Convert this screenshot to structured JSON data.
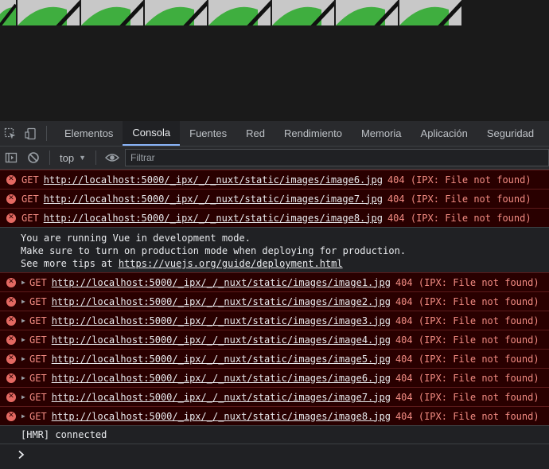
{
  "tabs": [
    {
      "label": "Elementos"
    },
    {
      "label": "Consola",
      "active": true
    },
    {
      "label": "Fuentes"
    },
    {
      "label": "Red"
    },
    {
      "label": "Rendimiento"
    },
    {
      "label": "Memoria"
    },
    {
      "label": "Aplicación"
    },
    {
      "label": "Seguridad"
    }
  ],
  "toolbar": {
    "context": "top",
    "filter_placeholder": "Filtrar"
  },
  "icons": {
    "inspect": "inspect-element-icon",
    "device": "device-toolbar-icon",
    "sidebar": "show-sidebar-icon",
    "clear": "clear-console-icon",
    "eye": "live-expression-icon",
    "error": "error-icon",
    "expand": "expand-arrow-icon",
    "prompt": "console-prompt-icon"
  },
  "colors": {
    "error_bg": "#290000",
    "error_text": "#f28b82",
    "active_tab": "#8ab4f8"
  },
  "console": {
    "errors_top": [
      {
        "method": "GET",
        "url": "http://localhost:5000/_ipx/_/_nuxt/static/images/image6.jpg",
        "status": "404 (IPX: File not found)"
      },
      {
        "method": "GET",
        "url": "http://localhost:5000/_ipx/_/_nuxt/static/images/image7.jpg",
        "status": "404 (IPX: File not found)"
      },
      {
        "method": "GET",
        "url": "http://localhost:5000/_ipx/_/_nuxt/static/images/image8.jpg",
        "status": "404 (IPX: File not found)"
      }
    ],
    "vue_message": {
      "line1": "You are running Vue in development mode.",
      "line2": "Make sure to turn on production mode when deploying for production.",
      "line3_prefix": "See more tips at ",
      "line3_link": "https://vuejs.org/guide/deployment.html"
    },
    "errors_bottom": [
      {
        "method": "GET",
        "url": "http://localhost:5000/_ipx/_/_nuxt/static/images/image1.jpg",
        "status": "404 (IPX: File not found)"
      },
      {
        "method": "GET",
        "url": "http://localhost:5000/_ipx/_/_nuxt/static/images/image2.jpg",
        "status": "404 (IPX: File not found)"
      },
      {
        "method": "GET",
        "url": "http://localhost:5000/_ipx/_/_nuxt/static/images/image3.jpg",
        "status": "404 (IPX: File not found)"
      },
      {
        "method": "GET",
        "url": "http://localhost:5000/_ipx/_/_nuxt/static/images/image4.jpg",
        "status": "404 (IPX: File not found)"
      },
      {
        "method": "GET",
        "url": "http://localhost:5000/_ipx/_/_nuxt/static/images/image5.jpg",
        "status": "404 (IPX: File not found)"
      },
      {
        "method": "GET",
        "url": "http://localhost:5000/_ipx/_/_nuxt/static/images/image6.jpg",
        "status": "404 (IPX: File not found)"
      },
      {
        "method": "GET",
        "url": "http://localhost:5000/_ipx/_/_nuxt/static/images/image7.jpg",
        "status": "404 (IPX: File not found)"
      },
      {
        "method": "GET",
        "url": "http://localhost:5000/_ipx/_/_nuxt/static/images/image8.jpg",
        "status": "404 (IPX: File not found)"
      }
    ],
    "hmr": "[HMR] connected"
  }
}
